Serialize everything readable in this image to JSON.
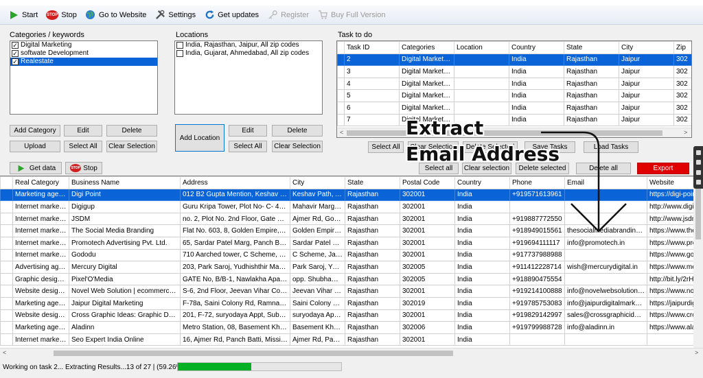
{
  "toolbar": {
    "start": "Start",
    "stop": "Stop",
    "stop_badge": "STOP",
    "go_to_website": "Go to Website",
    "settings": "Settings",
    "get_updates": "Get updates",
    "register": "Register",
    "buy_full_version": "Buy Full Version"
  },
  "categories": {
    "label": "Categories / keywords",
    "items": [
      {
        "label": "Digital Marketing",
        "checked": true,
        "selected": false
      },
      {
        "label": "softwate Development",
        "checked": true,
        "selected": false
      },
      {
        "label": "Realestate",
        "checked": true,
        "selected": true
      }
    ],
    "add": "Add Category",
    "edit": "Edit",
    "delete": "Delete",
    "upload": "Upload",
    "select_all": "Select All",
    "clear_selection": "Clear Selection"
  },
  "locations": {
    "label": "Locations",
    "items": [
      {
        "label": "India, Rajasthan, Jaipur, All zip codes",
        "checked": false
      },
      {
        "label": "India, Gujarat, Ahmedabad, All zip codes",
        "checked": false
      }
    ],
    "add": "Add Location",
    "edit": "Edit",
    "delete": "Delete",
    "select_all": "Select All",
    "clear_selection": "Clear Selection"
  },
  "tasks": {
    "label": "Task to do",
    "columns": [
      "Task ID",
      "Categories",
      "Location",
      "Country",
      "State",
      "City",
      "Zip"
    ],
    "rows": [
      [
        "2",
        "Digital Marketing",
        "",
        "India",
        "Rajasthan",
        "Jaipur",
        "302"
      ],
      [
        "3",
        "Digital Marketing",
        "",
        "India",
        "Rajasthan",
        "Jaipur",
        "302"
      ],
      [
        "4",
        "Digital Marketing",
        "",
        "India",
        "Rajasthan",
        "Jaipur",
        "302"
      ],
      [
        "5",
        "Digital Marketing",
        "",
        "India",
        "Rajasthan",
        "Jaipur",
        "302"
      ],
      [
        "6",
        "Digital Marketing",
        "",
        "India",
        "Rajasthan",
        "Jaipur",
        "302"
      ],
      [
        "7",
        "Digital Marketing",
        "",
        "India",
        "Rajasthan",
        "Jaipur",
        "302"
      ]
    ],
    "select_all": "Select All",
    "clear_selection": "Clear Selection",
    "delete_selected": "Delete Selected",
    "save_tasks": "Save Tasks",
    "load_tasks": "Load Tasks"
  },
  "results_toolbar": {
    "get_data": "Get data",
    "stop": "Stop",
    "stop_badge": "STOP",
    "select_all": "Select all",
    "clear_selection": "Clear selection",
    "delete_selected": "Delete selected",
    "delete_all": "Delete all",
    "export": "Export"
  },
  "results": {
    "columns": [
      "Real Category",
      "Business Name",
      "Address",
      "City",
      "State",
      "Postal Code",
      "Country",
      "Phone",
      "Email",
      "Website"
    ],
    "rows": [
      [
        "Marketing agency",
        "Digi Point",
        "012 B2 Gupta Mention, Keshav Path, ...",
        "Keshav Path, Ahi...",
        "Rajasthan",
        "302001",
        "India",
        "+919571613961",
        "",
        "https://digi-point-d"
      ],
      [
        "Internet marketin...",
        "Digigup",
        "Guru Kripa Tower, Plot No- C- 43, 601,...",
        "Mahavir Marg, C ...",
        "Rajasthan",
        "302001",
        "India",
        "",
        "",
        "http://www.digigu"
      ],
      [
        "Internet marketin...",
        "JSDM",
        "no. 2, Plot No. 2nd Floor, Gate 48, Aj...",
        "Ajmer Rd, Gopalb...",
        "Rajasthan",
        "302001",
        "India",
        "+919887772550",
        "",
        "http://www.jsdm.i"
      ],
      [
        "Internet marketin...",
        "The Social Media Branding",
        "Flat No. 603, 8, Golden Empire, Maha...",
        "Golden Empire, ...",
        "Rajasthan",
        "302001",
        "India",
        "+918949015561",
        "thesocialmediabranding@g...",
        "https://www.theso"
      ],
      [
        "Internet marketin...",
        "Promotech Advertising Pvt. Ltd.",
        "65, Sardar Patel Marg, Panch Batti, Pa...",
        "Sardar Patel Mar...",
        "Rajasthan",
        "302001",
        "India",
        "+919694111117",
        "info@promotech.in",
        "https://www.prom"
      ],
      [
        "Internet marketin...",
        "Gododu",
        "710 Aarched tower, C Scheme, Jaipur,...",
        "C Scheme, Jaipur,...",
        "Rajasthan",
        "302001",
        "India",
        "+917737988988",
        "",
        "https://www.godo"
      ],
      [
        "Advertising agency",
        "Mercury Digital",
        "203, Park Saroj, Yudhishthir Marg, Ash...",
        "Park Saroj, Yudhi...",
        "Rajasthan",
        "302005",
        "India",
        "+911412228714",
        "wish@mercurydigital.in",
        "https://www.merc"
      ],
      [
        "Graphic designer",
        "Pixel'O'Media",
        "GATE No, B/B-1, Nawlakha Apartmen...",
        "opp. Shubham E...",
        "Rajasthan",
        "302005",
        "India",
        "+918890475554",
        "",
        "http://bit.ly/2rHva"
      ],
      [
        "Website designer",
        "Novel Web Solution | ecommerce We...",
        "S-6, 2nd Floor, Jeevan Vihar Complex, ...",
        "Jeevan Vihar Co...",
        "Rajasthan",
        "302001",
        "India",
        "+919214100888",
        "info@novelwebsolution.com",
        "https://www.nove"
      ],
      [
        "Marketing agency",
        "Jaipur Digital Marketing",
        "F-78a, Saini Colony Rd, Ramnagar Ext...",
        "Saini Colony Rd, ...",
        "Rajasthan",
        "302019",
        "India",
        "+919785753083",
        "info@jaipurdigitalmarketing....",
        "https://jaipurdigita"
      ],
      [
        "Website designer",
        "Cross Graphic Ideas: Graphic Designer...",
        "201, F-72, suryodaya Appt, Subhash ...",
        "suryodaya Appt, ...",
        "Rajasthan",
        "302001",
        "India",
        "+919829142997",
        "sales@crossgraphicideas.c...",
        "https://www.cross"
      ],
      [
        "Marketing agency",
        "Aladinn",
        "Metro Station, 08, Basement Khaliya H...",
        "Basement Khaliy...",
        "Rajasthan",
        "302006",
        "India",
        "+919799988728",
        "info@aladinn.in",
        "https://www.aladi"
      ],
      [
        "Internet marketin...",
        "Seo Expert India Online",
        "16, Ajmer Rd, Panch Batti, Mission Co...",
        "Ajmer Rd, Panch ...",
        "Rajasthan",
        "302001",
        "India",
        "",
        "",
        ""
      ]
    ]
  },
  "overlay": {
    "line1": "Extract",
    "line2": "Email Address"
  },
  "status": {
    "text": "Working on task 2... Extracting Results...13 of 27 | (59.26%)...",
    "progress": 0.45
  },
  "colors": {
    "selection": "#0a64d8",
    "progress": "#06b025",
    "export": "#e00000"
  }
}
